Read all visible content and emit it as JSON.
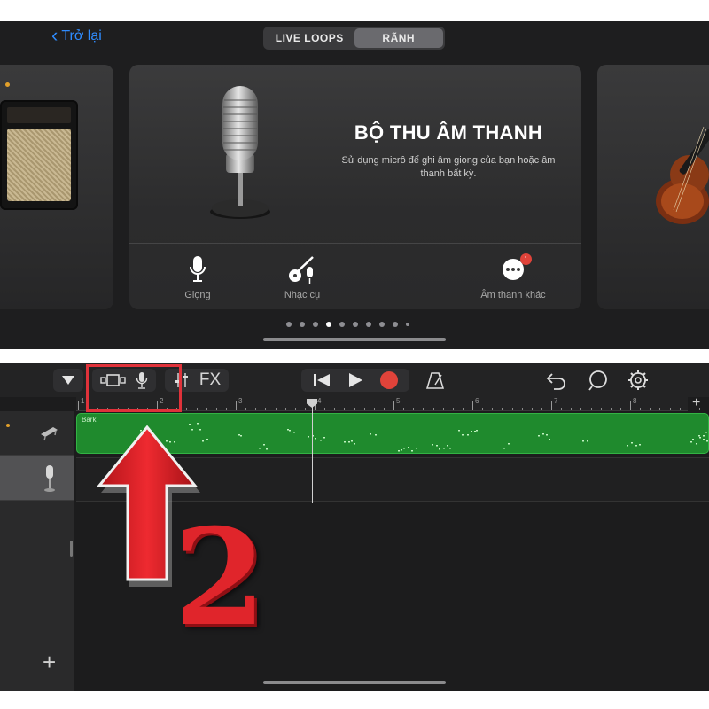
{
  "top": {
    "back_label": "Trở lại",
    "segments": [
      {
        "label": "LIVE LOOPS",
        "active": false
      },
      {
        "label": "RÃNH",
        "active": true
      }
    ],
    "card_title": "BỘ THU ÂM THANH",
    "card_subtitle": "Sử dụng micrô để ghi âm giọng của bạn hoặc âm thanh bất kỳ.",
    "options": [
      {
        "label": "Giọng",
        "icon": "microphone-icon"
      },
      {
        "label": "Nhạc cụ",
        "icon": "guitar-mic-icon"
      },
      {
        "label": "Âm thanh khác",
        "icon": "more-icon",
        "badge": "1"
      }
    ],
    "page_dots": {
      "count": 10,
      "active_index": 3
    }
  },
  "bottom": {
    "toolbar": {
      "fx_label": "FX"
    },
    "ruler_numbers": [
      "1",
      "2",
      "3",
      "4",
      "5",
      "6",
      "7",
      "8"
    ],
    "region_name": "Bark",
    "region_color": "#1f8a2d",
    "record_color": "#e0433a"
  },
  "annotation": {
    "step_number": "2",
    "box_color": "#e0323a"
  }
}
